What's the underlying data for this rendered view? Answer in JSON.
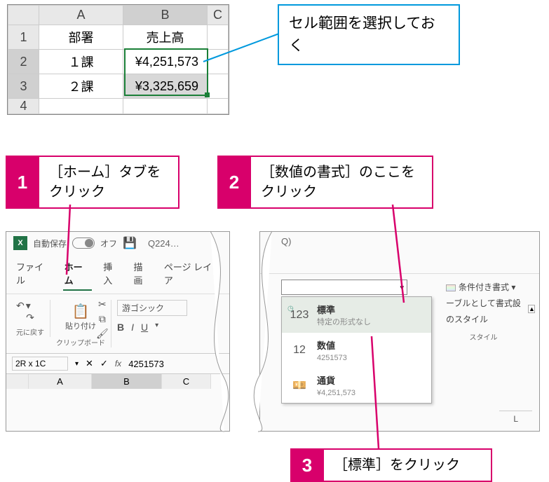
{
  "callouts": {
    "select_range": "セル範囲を選択しておく",
    "step1": {
      "num": "1",
      "text": "［ホーム］タブをクリック"
    },
    "step2": {
      "num": "2",
      "text": "［数値の書式］のここをクリック"
    },
    "step3": {
      "num": "3",
      "text": "［標準］をクリック"
    }
  },
  "sheet": {
    "cols": {
      "A": "A",
      "B": "B",
      "C": "C"
    },
    "rows": [
      "1",
      "2",
      "3",
      "4"
    ],
    "headers": {
      "dept": "部署",
      "sales": "売上高"
    },
    "data": [
      {
        "dept": "１課",
        "sales": "¥4,251,573"
      },
      {
        "dept": "２課",
        "sales": "¥3,325,659"
      }
    ]
  },
  "ribbon": {
    "autosave_label": "自動保存",
    "autosave_state": "オフ",
    "doc": "Q224…",
    "search_placeholder": "Q)",
    "tabs": {
      "file": "ファイル",
      "home": "ホーム",
      "insert": "挿入",
      "draw": "描画",
      "layout": "ページ レイア"
    },
    "undo_group": "元に戻す",
    "paste": "貼り付け",
    "clipboard_group": "クリップボード",
    "font_name": "游ゴシック",
    "bold": "B",
    "italic": "I",
    "underline": "U",
    "cond_fmt": "条件付き書式",
    "as_table": "ーブルとして書式設",
    "cell_styles": "のスタイル",
    "styles_group": "スタイル",
    "col_L": "L",
    "namebox": "2R x 1C",
    "formula_value": "4251573"
  },
  "format_menu": {
    "standard": {
      "title": "標準",
      "sub": "特定の形式なし",
      "icon": "123"
    },
    "number": {
      "title": "数値",
      "sub": "4251573",
      "icon": "12"
    },
    "currency": {
      "title": "通貨",
      "sub": "¥4,251,573"
    }
  }
}
